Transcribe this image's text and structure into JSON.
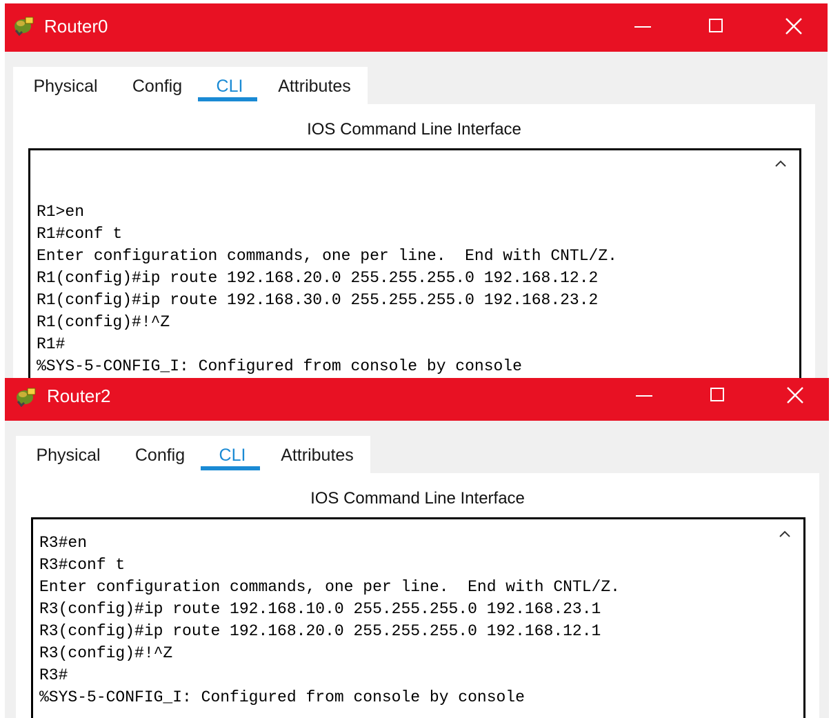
{
  "windows": [
    {
      "title": "Router0",
      "tabs": [
        "Physical",
        "Config",
        "CLI",
        "Attributes"
      ],
      "active_tab": "CLI",
      "panel_title": "IOS Command Line Interface",
      "cli_lines": [
        "R1>en",
        "R1#conf t",
        "Enter configuration commands, one per line.  End with CNTL/Z.",
        "R1(config)#ip route 192.168.20.0 255.255.255.0 192.168.12.2",
        "R1(config)#ip route 192.168.30.0 255.255.255.0 192.168.23.2",
        "R1(config)#!^Z",
        "R1#",
        "%SYS-5-CONFIG_I: Configured from console by console"
      ]
    },
    {
      "title": "Router2",
      "tabs": [
        "Physical",
        "Config",
        "CLI",
        "Attributes"
      ],
      "active_tab": "CLI",
      "panel_title": "IOS Command Line Interface",
      "cli_lines": [
        "R3#en",
        "R3#conf t",
        "Enter configuration commands, one per line.  End with CNTL/Z.",
        "R3(config)#ip route 192.168.10.0 255.255.255.0 192.168.23.1",
        "R3(config)#ip route 192.168.20.0 255.255.255.0 192.168.12.1",
        "R3(config)#!^Z",
        "R3#",
        "%SYS-5-CONFIG_I: Configured from console by console"
      ]
    }
  ],
  "icons": {
    "app": "router-app-icon",
    "minimize": "minimize-icon",
    "maximize": "maximize-icon",
    "close": "close-icon",
    "scroll_up": "scroll-up-arrow-icon"
  },
  "colors": {
    "title_bar": "#e81123",
    "active_tab": "#1a8ad4",
    "window_bg": "#f0f0f0"
  }
}
